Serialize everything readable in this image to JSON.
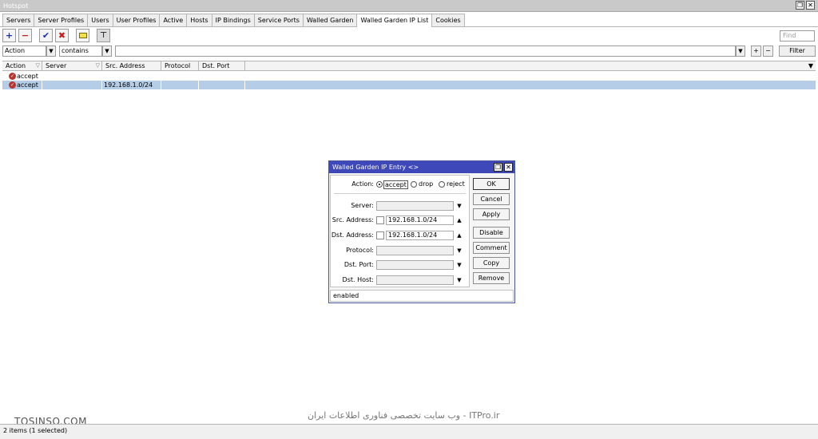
{
  "window": {
    "title": "Hotspot",
    "restore_glyph": "❐",
    "close_glyph": "✕"
  },
  "tabs": [
    {
      "label": "Servers"
    },
    {
      "label": "Server Profiles"
    },
    {
      "label": "Users"
    },
    {
      "label": "User Profiles"
    },
    {
      "label": "Active"
    },
    {
      "label": "Hosts"
    },
    {
      "label": "IP Bindings"
    },
    {
      "label": "Service Ports"
    },
    {
      "label": "Walled Garden"
    },
    {
      "label": "Walled Garden IP List"
    },
    {
      "label": "Cookies"
    }
  ],
  "toolbar": {
    "add_glyph": "+",
    "remove_glyph": "−",
    "enable_glyph": "✔",
    "disable_glyph": "✖",
    "comment_glyph": "▭",
    "filter_glyph": "⊤",
    "find_placeholder": "Find"
  },
  "filterbar": {
    "field": "Action",
    "op": "contains",
    "value": "",
    "add_glyph": "+",
    "remove_glyph": "−",
    "filter_label": "Filter",
    "arrow": "▼"
  },
  "grid": {
    "columns": [
      "Action",
      "Server",
      "Src. Address",
      "Protocol",
      "Dst. Port"
    ],
    "menu_glyph": "▼",
    "sort_glyph": "▽",
    "rows": [
      {
        "action": "accept",
        "server": "",
        "src": "",
        "protocol": "",
        "dst_port": ""
      },
      {
        "action": "accept",
        "server": "",
        "src": "192.168.1.0/24",
        "protocol": "",
        "dst_port": ""
      }
    ],
    "icon_glyph": "✓"
  },
  "dialog": {
    "title": "Walled Garden IP Entry <>",
    "restore_glyph": "❐",
    "close_glyph": "✕",
    "action_label": "Action:",
    "action_options": [
      "accept",
      "drop",
      "reject"
    ],
    "server_label": "Server:",
    "src_label": "Src. Address:",
    "src_value": "192.168.1.0/24",
    "dst_label": "Dst. Address:",
    "dst_value": "192.168.1.0/24",
    "protocol_label": "Protocol:",
    "dst_port_label": "Dst. Port:",
    "dst_host_label": "Dst. Host:",
    "drop_arrow": "▼",
    "up_arrow": "▲",
    "buttons": [
      "OK",
      "Cancel",
      "Apply",
      "Disable",
      "Comment",
      "Copy",
      "Remove"
    ],
    "status": "enabled"
  },
  "statusbar": {
    "text": "2 items (1 selected)"
  },
  "watermarks": {
    "left": "TOSINSO.COM",
    "center": "ITPro.ir - وب سایت تخصصی فناوری اطلاعات ایران"
  }
}
